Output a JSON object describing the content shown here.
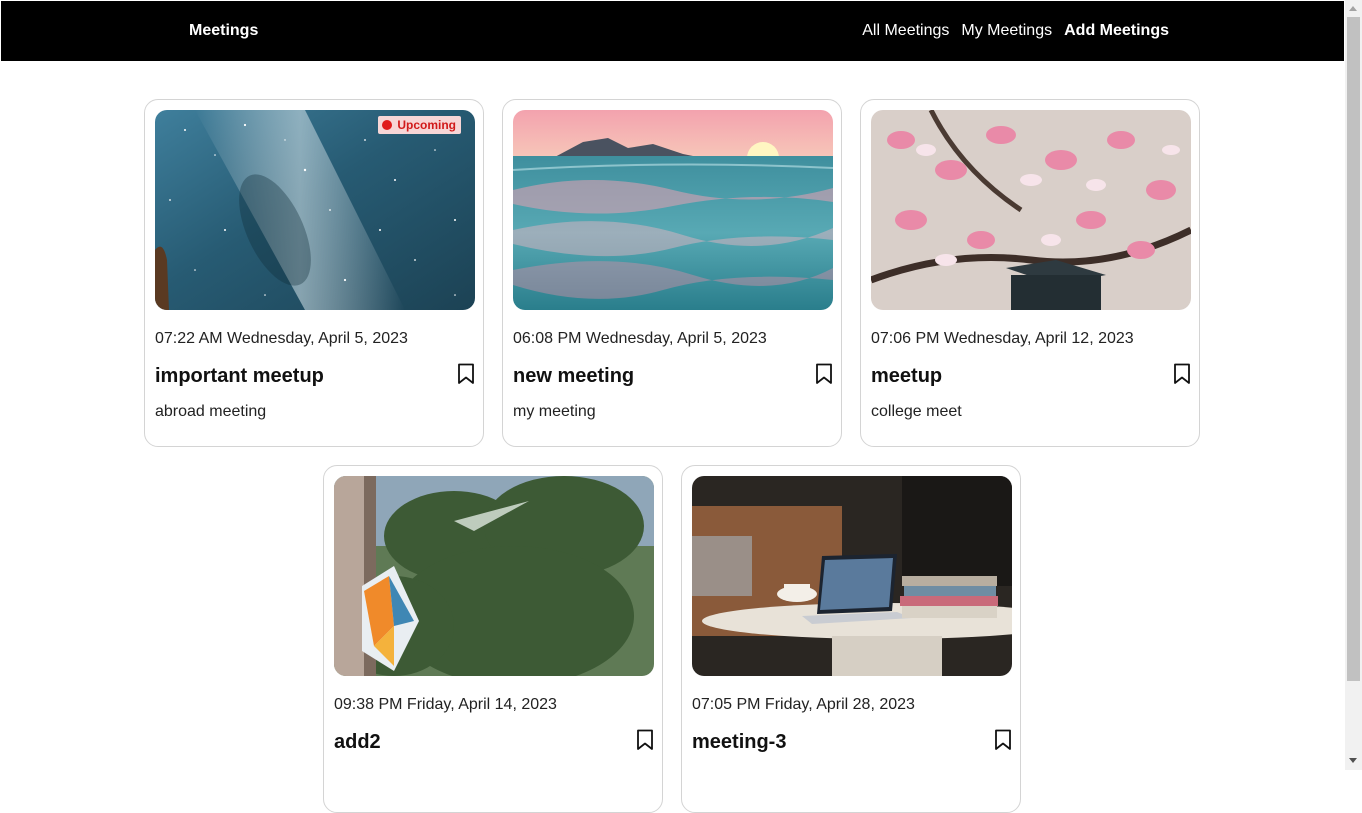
{
  "navbar": {
    "brand": "Meetings",
    "links": [
      {
        "label": "All Meetings",
        "active": false
      },
      {
        "label": "My Meetings",
        "active": false
      },
      {
        "label": "Add Meetings",
        "active": true
      }
    ]
  },
  "meetings": [
    {
      "datetime": "07:22 AM Wednesday, April 5, 2023",
      "title": "important meetup",
      "description": "abroad meeting",
      "badge": "Upcoming",
      "image": "night-sky-milky-way"
    },
    {
      "datetime": "06:08 PM Wednesday, April 5, 2023",
      "title": "new meeting",
      "description": "my meeting",
      "image": "ocean-sunset"
    },
    {
      "datetime": "07:06 PM Wednesday, April 12, 2023",
      "title": "meetup",
      "description": "college meet",
      "image": "magnolia-blossoms-graduation-cap"
    },
    {
      "datetime": "09:38 PM Friday, April 14, 2023",
      "title": "add2",
      "description": "",
      "image": "kaleidico-window-sign"
    },
    {
      "datetime": "07:05 PM Friday, April 28, 2023",
      "title": "meeting-3",
      "description": "",
      "image": "laptop-on-coffee-table"
    }
  ],
  "colors": {
    "navbar_bg": "#000000",
    "badge_bg": "#f7d6d6",
    "badge_text": "#d11a1a"
  }
}
